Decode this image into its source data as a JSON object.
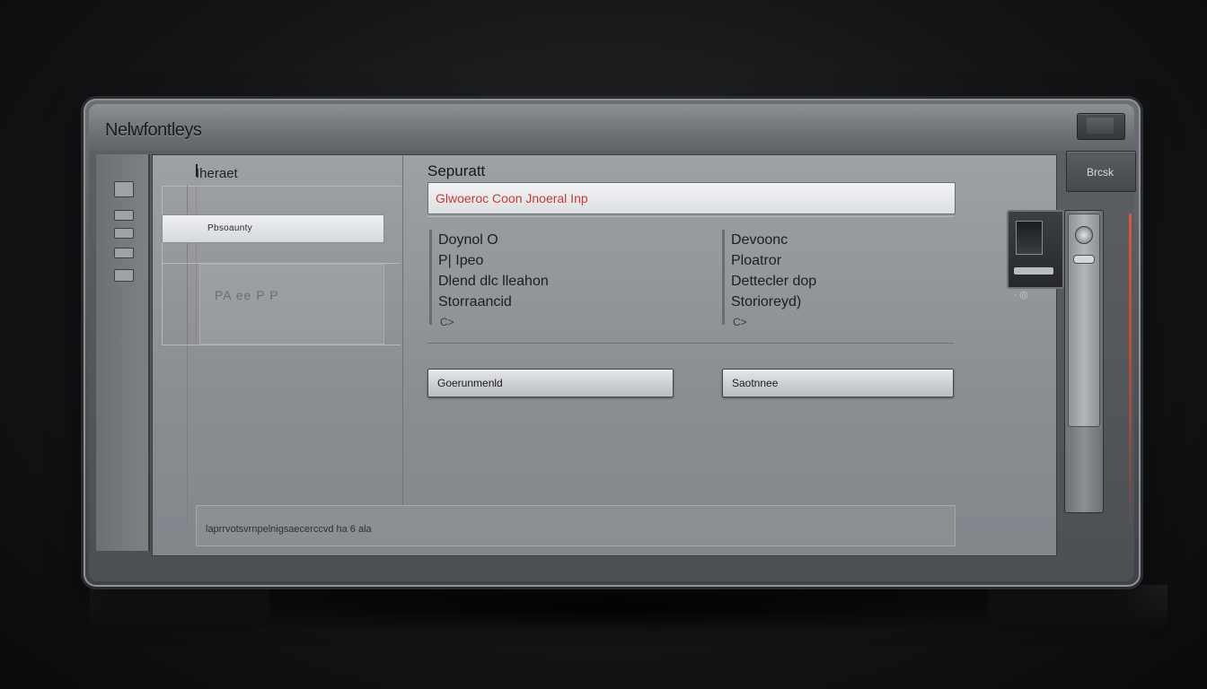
{
  "window": {
    "title": "Nelwfontleys"
  },
  "nav": {
    "header": "Iheraet",
    "selected_item": "Pbsoaunty",
    "group_label": "PA ee P P"
  },
  "main": {
    "section_title": "Sepuratt",
    "search_value": "Glwoeroc Coon Jnoeral Inp",
    "details_left": {
      "rows": [
        "Doynol O",
        "P| Ipeo",
        "Dlend dlc lleahon",
        "Storraancid"
      ],
      "mini": "C>"
    },
    "details_right": {
      "rows": [
        "Devoonc",
        "Ploatror",
        "Dettecler dop",
        "Storioreyd)"
      ],
      "mini": "C>"
    },
    "button_left": "Goerunmenld",
    "button_right": "Saotnnee"
  },
  "status": {
    "text": "laprrvotsvrnpelnigsaecerccvd ha 6 ala"
  },
  "side": {
    "tab_label": "Brcsk",
    "module_dots": "∙  ◎"
  },
  "colors": {
    "accent": "#c83a32",
    "glow": "#e0553a"
  }
}
